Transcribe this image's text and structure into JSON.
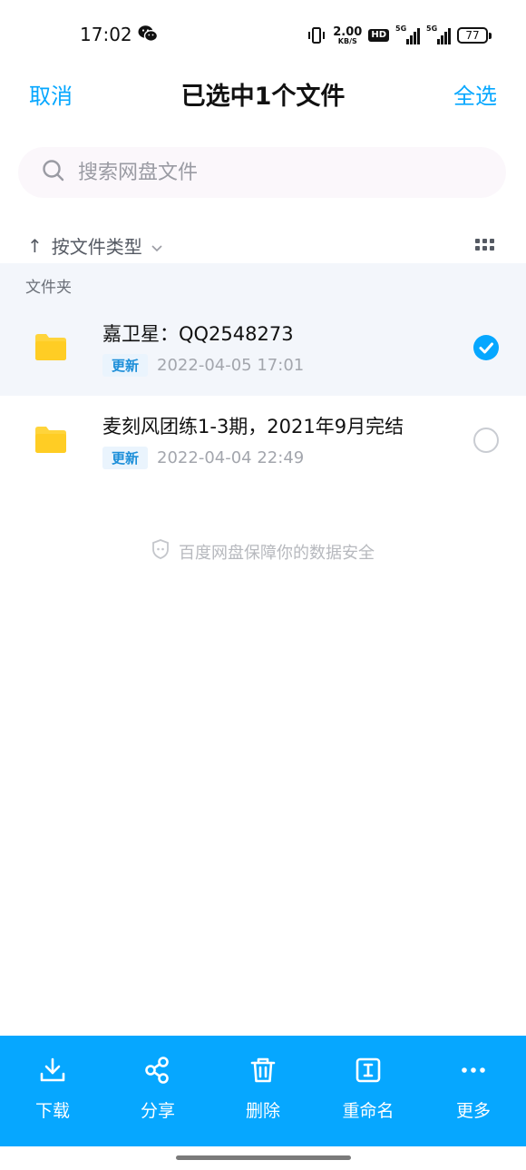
{
  "status_bar": {
    "time": "17:02",
    "app_icon": "wechat-icon",
    "net_speed_value": "2.00",
    "net_speed_unit": "KB/S",
    "hd_label": "HD",
    "sim1_label": "5G",
    "sim2_label": "5G",
    "battery": "77"
  },
  "header": {
    "cancel_label": "取消",
    "title": "已选中1个文件",
    "select_all_label": "全选"
  },
  "search": {
    "placeholder": "搜索网盘文件",
    "icon": "search-icon"
  },
  "sort": {
    "arrow": "↑",
    "label": "按文件类型",
    "view_icon": "grid-view-icon"
  },
  "section": {
    "label": "文件夹"
  },
  "files": [
    {
      "name": "嘉卫星：QQ2548273",
      "badge": "更新",
      "date": "2022-04-05  17:01",
      "selected": true,
      "icon": "folder-icon"
    },
    {
      "name": "麦刻风团练1-3期，2021年9月完结",
      "badge": "更新",
      "date": "2022-04-04  22:49",
      "selected": false,
      "icon": "folder-icon"
    }
  ],
  "security_notice": "百度网盘保障你的数据安全",
  "toolbar": {
    "items": [
      {
        "label": "下载",
        "icon": "download-icon"
      },
      {
        "label": "分享",
        "icon": "share-icon"
      },
      {
        "label": "删除",
        "icon": "trash-icon"
      },
      {
        "label": "重命名",
        "icon": "rename-icon"
      },
      {
        "label": "更多",
        "icon": "more-icon"
      }
    ]
  },
  "colors": {
    "accent": "#06a7ff",
    "folder": "#ffd43b",
    "badge_text": "#1d8fd9",
    "selected_row_bg": "#f3f6fb"
  }
}
